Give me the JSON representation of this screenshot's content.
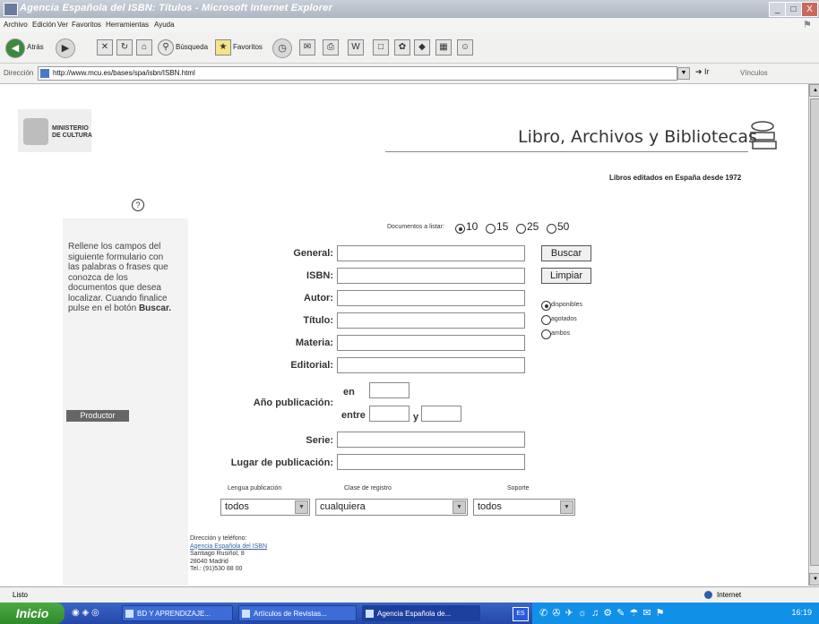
{
  "window": {
    "title": "Agencia Española del ISBN: Títulos - Microsoft Internet Explorer",
    "buttons": [
      "_",
      "□",
      "X"
    ]
  },
  "menubar": {
    "items": [
      "Archivo",
      "Edición",
      "Ver",
      "Favoritos",
      "Herramientas",
      "Ayuda"
    ]
  },
  "toolbar": {
    "back_label": "Atrás",
    "search_label": "Búsqueda",
    "favorites_label": "Favoritos"
  },
  "addressbar": {
    "label": "Dirección",
    "url": "http://www.mcu.es/bases/spa/isbn/ISBN.html",
    "go_label": "Ir",
    "links_label": "Vínculos"
  },
  "page": {
    "ministry": "MINISTERIO\nDE CULTURA",
    "site_title": "Libro, Archivos y Bibliotecas",
    "subtitle": "Libros editados en España desde 1972",
    "help_icon": "?",
    "sidebar_text": "Rellene los campos del siguiente formulario con las palabras o frases que conozca de los documentos que desea localizar. Cuando finalice pulse en el botón",
    "sidebar_bold": "Buscar.",
    "productor_label": "Productor",
    "docs_label": "Documentos a listar:",
    "docs_options": [
      "10",
      "15",
      "25",
      "50"
    ],
    "docs_selected": "10",
    "fields": {
      "general": "General:",
      "isbn": "ISBN:",
      "autor": "Autor:",
      "titulo": "Título:",
      "materia": "Materia:",
      "editorial": "Editorial:",
      "anio": "Año publicación:",
      "en": "en",
      "entre": "entre",
      "y": "y",
      "serie": "Serie:",
      "lugar": "Lugar de publicación:"
    },
    "buttons": {
      "buscar": "Buscar",
      "limpiar": "Limpiar"
    },
    "availability": {
      "options": [
        "disponibles",
        "agotados",
        "ambos"
      ],
      "selected": "disponibles"
    },
    "selects": {
      "lengua_label": "Lengua publicación",
      "lengua_value": "todos",
      "clase_label": "Clase de registro",
      "clase_value": "cualquiera",
      "soporte_label": "Soporte",
      "soporte_value": "todos"
    },
    "address": {
      "heading": "Dirección y teléfono:",
      "agency": "Agencia Española del ISBN",
      "street": "Santiago Rusiñol, 8",
      "city": "28040 Madrid",
      "phone": "Tel.: (91)530 88 00"
    }
  },
  "statusbar": {
    "text": "Listo",
    "zone": "Internet"
  },
  "taskbar": {
    "start_label": "Inicio",
    "tasks": [
      "BD Y APRENDIZAJE...",
      "Artículos de Revistas...",
      "Agencia Española de..."
    ],
    "lang": "ES",
    "clock": "16:19"
  }
}
